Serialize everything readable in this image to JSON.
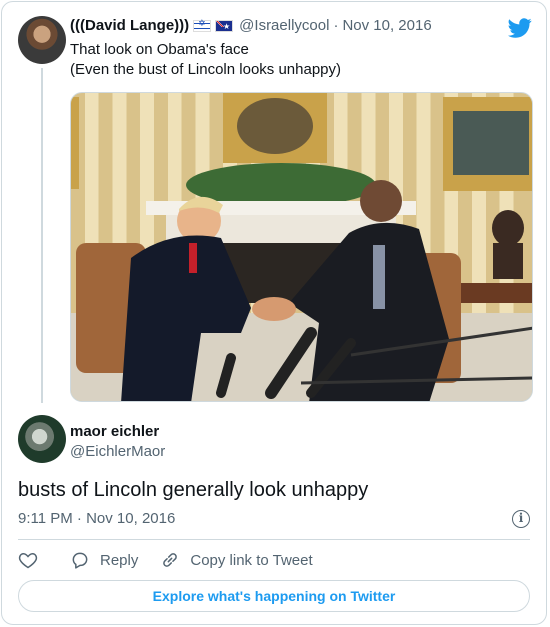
{
  "quoted_tweet": {
    "author_name": "(((David Lange)))",
    "flags": [
      "israel-flag",
      "australia-flag"
    ],
    "handle": "@Israellycool",
    "separator": "·",
    "date": "Nov 10, 2016",
    "text_line1": "That look on Obama's face",
    "text_line2": "(Even the bust of Lincoln looks unhappy)",
    "photo_icon": "photo-image"
  },
  "reply": {
    "author_name": "maor eichler",
    "handle": "@EichlerMaor",
    "text": "busts of Lincoln generally look unhappy",
    "timestamp": "9:11 PM · Nov 10, 2016",
    "info_symbol": "i"
  },
  "actions": {
    "like_icon": "heart-icon",
    "reply_label": "Reply",
    "copy_link_label": "Copy link to Tweet"
  },
  "footer": {
    "explore_label": "Explore what's happening on Twitter"
  },
  "colors": {
    "accent": "#1d9bf0",
    "muted": "#536471",
    "border": "#cfd9de"
  }
}
